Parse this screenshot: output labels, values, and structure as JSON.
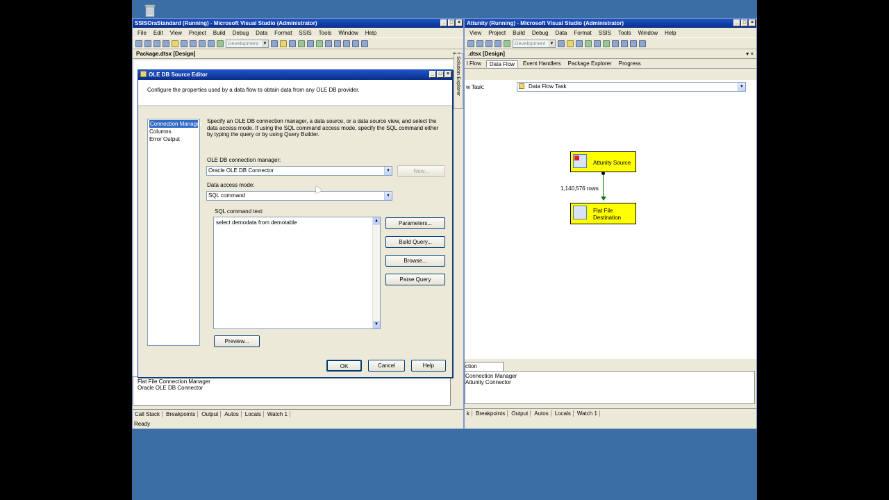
{
  "left_window": {
    "title": "SSISOraStandard (Running) - Microsoft Visual Studio (Administrator)",
    "menu": [
      "File",
      "Edit",
      "View",
      "Project",
      "Build",
      "Debug",
      "Data",
      "Format",
      "SSIS",
      "Tools",
      "Window",
      "Help"
    ],
    "config_combo": "Development",
    "doc_tab": "Package.dtsx [Design]",
    "solution_explorer_label": "Solution Explorer",
    "conn_managers": [
      "Flat File Connection Manager",
      "Oracle OLE DB Connector"
    ],
    "bottom_tabs": [
      "Call Stack",
      "Breakpoints",
      "Output",
      "Autos",
      "Locals",
      "Watch 1"
    ],
    "status": "Ready"
  },
  "right_window": {
    "title": "Attunity (Running) - Microsoft Visual Studio (Administrator)",
    "menu": [
      "View",
      "Project",
      "Build",
      "Debug",
      "Data",
      "Format",
      "SSIS",
      "Tools",
      "Window",
      "Help"
    ],
    "config_combo": "Development",
    "doc_tab": ".dtsx [Design]",
    "design_tabs": [
      "l Flow",
      "Data Flow",
      "Event Handlers",
      "Package Explorer",
      "Progress"
    ],
    "task_label": "w Task:",
    "task_value": "Data Flow Task",
    "source_node": "Attunity Source",
    "dest_node_line1": "Flat File",
    "dest_node_line2": "Destination",
    "rows_label": "1,140,576 rows",
    "cm_tab": "ction Managers",
    "conn_managers": [
      "Connection Manager",
      "Attunity Connector"
    ],
    "bottom_tabs": [
      "k",
      "Breakpoints",
      "Output",
      "Autos",
      "Locals",
      "Watch 1"
    ]
  },
  "dialog": {
    "title": "OLE DB Source Editor",
    "description": "Configure the properties used by a data flow to obtain data from any OLE DB provider.",
    "nav": [
      "Connection Manager",
      "Columns",
      "Error Output"
    ],
    "instructions": "Specify an OLE DB connection manager, a data source, or a data source view, and select the data access mode. If using the SQL command access mode, specify the SQL command either by typing the query or by using Query Builder.",
    "conn_label": "OLE DB connection manager:",
    "conn_value": "Oracle OLE DB Connector",
    "new_button": "New...",
    "mode_label": "Data access mode:",
    "mode_value": "SQL command",
    "sql_label": "SQL command text:",
    "sql_value": "select demodata from demotable",
    "parameters_button": "Parameters...",
    "build_query_button": "Build Query...",
    "browse_button": "Browse...",
    "parse_query_button": "Parse Query",
    "preview_button": "Preview...",
    "ok_button": "OK",
    "cancel_button": "Cancel",
    "help_button": "Help"
  },
  "colors": {
    "desktop": "#3a6ea5",
    "titlebar": "#0a2e8a",
    "node": "#ffff00",
    "selection": "#316ac5"
  }
}
